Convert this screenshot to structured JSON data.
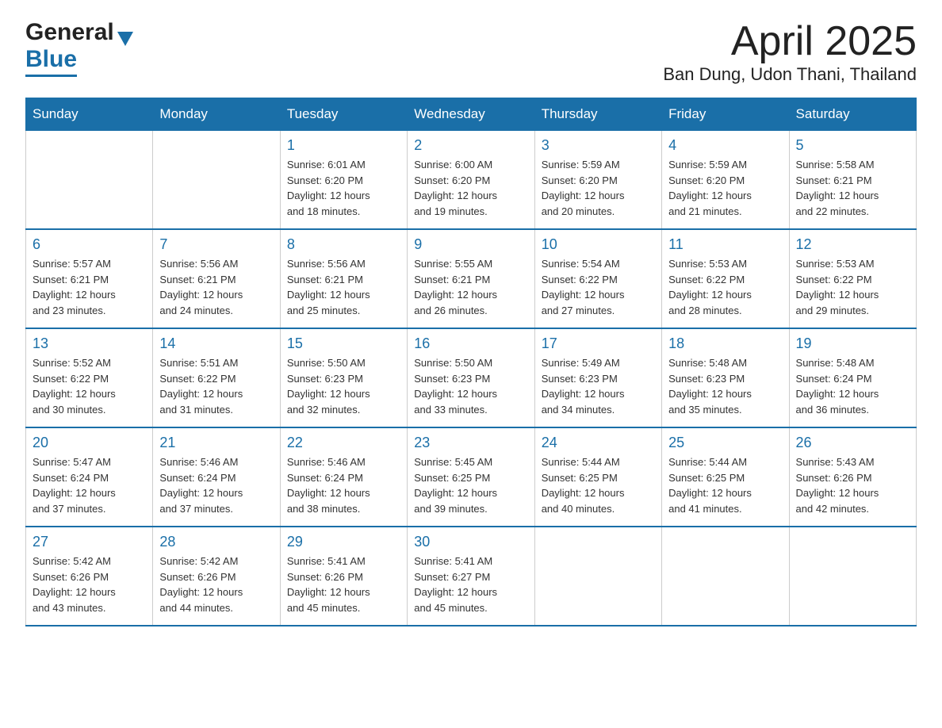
{
  "header": {
    "logo_general": "General",
    "logo_blue": "Blue",
    "title": "April 2025",
    "subtitle": "Ban Dung, Udon Thani, Thailand"
  },
  "days_of_week": [
    "Sunday",
    "Monday",
    "Tuesday",
    "Wednesday",
    "Thursday",
    "Friday",
    "Saturday"
  ],
  "weeks": [
    [
      {
        "day": "",
        "info": ""
      },
      {
        "day": "",
        "info": ""
      },
      {
        "day": "1",
        "info": "Sunrise: 6:01 AM\nSunset: 6:20 PM\nDaylight: 12 hours\nand 18 minutes."
      },
      {
        "day": "2",
        "info": "Sunrise: 6:00 AM\nSunset: 6:20 PM\nDaylight: 12 hours\nand 19 minutes."
      },
      {
        "day": "3",
        "info": "Sunrise: 5:59 AM\nSunset: 6:20 PM\nDaylight: 12 hours\nand 20 minutes."
      },
      {
        "day": "4",
        "info": "Sunrise: 5:59 AM\nSunset: 6:20 PM\nDaylight: 12 hours\nand 21 minutes."
      },
      {
        "day": "5",
        "info": "Sunrise: 5:58 AM\nSunset: 6:21 PM\nDaylight: 12 hours\nand 22 minutes."
      }
    ],
    [
      {
        "day": "6",
        "info": "Sunrise: 5:57 AM\nSunset: 6:21 PM\nDaylight: 12 hours\nand 23 minutes."
      },
      {
        "day": "7",
        "info": "Sunrise: 5:56 AM\nSunset: 6:21 PM\nDaylight: 12 hours\nand 24 minutes."
      },
      {
        "day": "8",
        "info": "Sunrise: 5:56 AM\nSunset: 6:21 PM\nDaylight: 12 hours\nand 25 minutes."
      },
      {
        "day": "9",
        "info": "Sunrise: 5:55 AM\nSunset: 6:21 PM\nDaylight: 12 hours\nand 26 minutes."
      },
      {
        "day": "10",
        "info": "Sunrise: 5:54 AM\nSunset: 6:22 PM\nDaylight: 12 hours\nand 27 minutes."
      },
      {
        "day": "11",
        "info": "Sunrise: 5:53 AM\nSunset: 6:22 PM\nDaylight: 12 hours\nand 28 minutes."
      },
      {
        "day": "12",
        "info": "Sunrise: 5:53 AM\nSunset: 6:22 PM\nDaylight: 12 hours\nand 29 minutes."
      }
    ],
    [
      {
        "day": "13",
        "info": "Sunrise: 5:52 AM\nSunset: 6:22 PM\nDaylight: 12 hours\nand 30 minutes."
      },
      {
        "day": "14",
        "info": "Sunrise: 5:51 AM\nSunset: 6:22 PM\nDaylight: 12 hours\nand 31 minutes."
      },
      {
        "day": "15",
        "info": "Sunrise: 5:50 AM\nSunset: 6:23 PM\nDaylight: 12 hours\nand 32 minutes."
      },
      {
        "day": "16",
        "info": "Sunrise: 5:50 AM\nSunset: 6:23 PM\nDaylight: 12 hours\nand 33 minutes."
      },
      {
        "day": "17",
        "info": "Sunrise: 5:49 AM\nSunset: 6:23 PM\nDaylight: 12 hours\nand 34 minutes."
      },
      {
        "day": "18",
        "info": "Sunrise: 5:48 AM\nSunset: 6:23 PM\nDaylight: 12 hours\nand 35 minutes."
      },
      {
        "day": "19",
        "info": "Sunrise: 5:48 AM\nSunset: 6:24 PM\nDaylight: 12 hours\nand 36 minutes."
      }
    ],
    [
      {
        "day": "20",
        "info": "Sunrise: 5:47 AM\nSunset: 6:24 PM\nDaylight: 12 hours\nand 37 minutes."
      },
      {
        "day": "21",
        "info": "Sunrise: 5:46 AM\nSunset: 6:24 PM\nDaylight: 12 hours\nand 37 minutes."
      },
      {
        "day": "22",
        "info": "Sunrise: 5:46 AM\nSunset: 6:24 PM\nDaylight: 12 hours\nand 38 minutes."
      },
      {
        "day": "23",
        "info": "Sunrise: 5:45 AM\nSunset: 6:25 PM\nDaylight: 12 hours\nand 39 minutes."
      },
      {
        "day": "24",
        "info": "Sunrise: 5:44 AM\nSunset: 6:25 PM\nDaylight: 12 hours\nand 40 minutes."
      },
      {
        "day": "25",
        "info": "Sunrise: 5:44 AM\nSunset: 6:25 PM\nDaylight: 12 hours\nand 41 minutes."
      },
      {
        "day": "26",
        "info": "Sunrise: 5:43 AM\nSunset: 6:26 PM\nDaylight: 12 hours\nand 42 minutes."
      }
    ],
    [
      {
        "day": "27",
        "info": "Sunrise: 5:42 AM\nSunset: 6:26 PM\nDaylight: 12 hours\nand 43 minutes."
      },
      {
        "day": "28",
        "info": "Sunrise: 5:42 AM\nSunset: 6:26 PM\nDaylight: 12 hours\nand 44 minutes."
      },
      {
        "day": "29",
        "info": "Sunrise: 5:41 AM\nSunset: 6:26 PM\nDaylight: 12 hours\nand 45 minutes."
      },
      {
        "day": "30",
        "info": "Sunrise: 5:41 AM\nSunset: 6:27 PM\nDaylight: 12 hours\nand 45 minutes."
      },
      {
        "day": "",
        "info": ""
      },
      {
        "day": "",
        "info": ""
      },
      {
        "day": "",
        "info": ""
      }
    ]
  ],
  "colors": {
    "header_bg": "#1a6fa8",
    "header_text": "#ffffff",
    "day_number": "#1a6fa8",
    "border": "#1a6fa8",
    "logo_blue": "#1a6fa8"
  }
}
